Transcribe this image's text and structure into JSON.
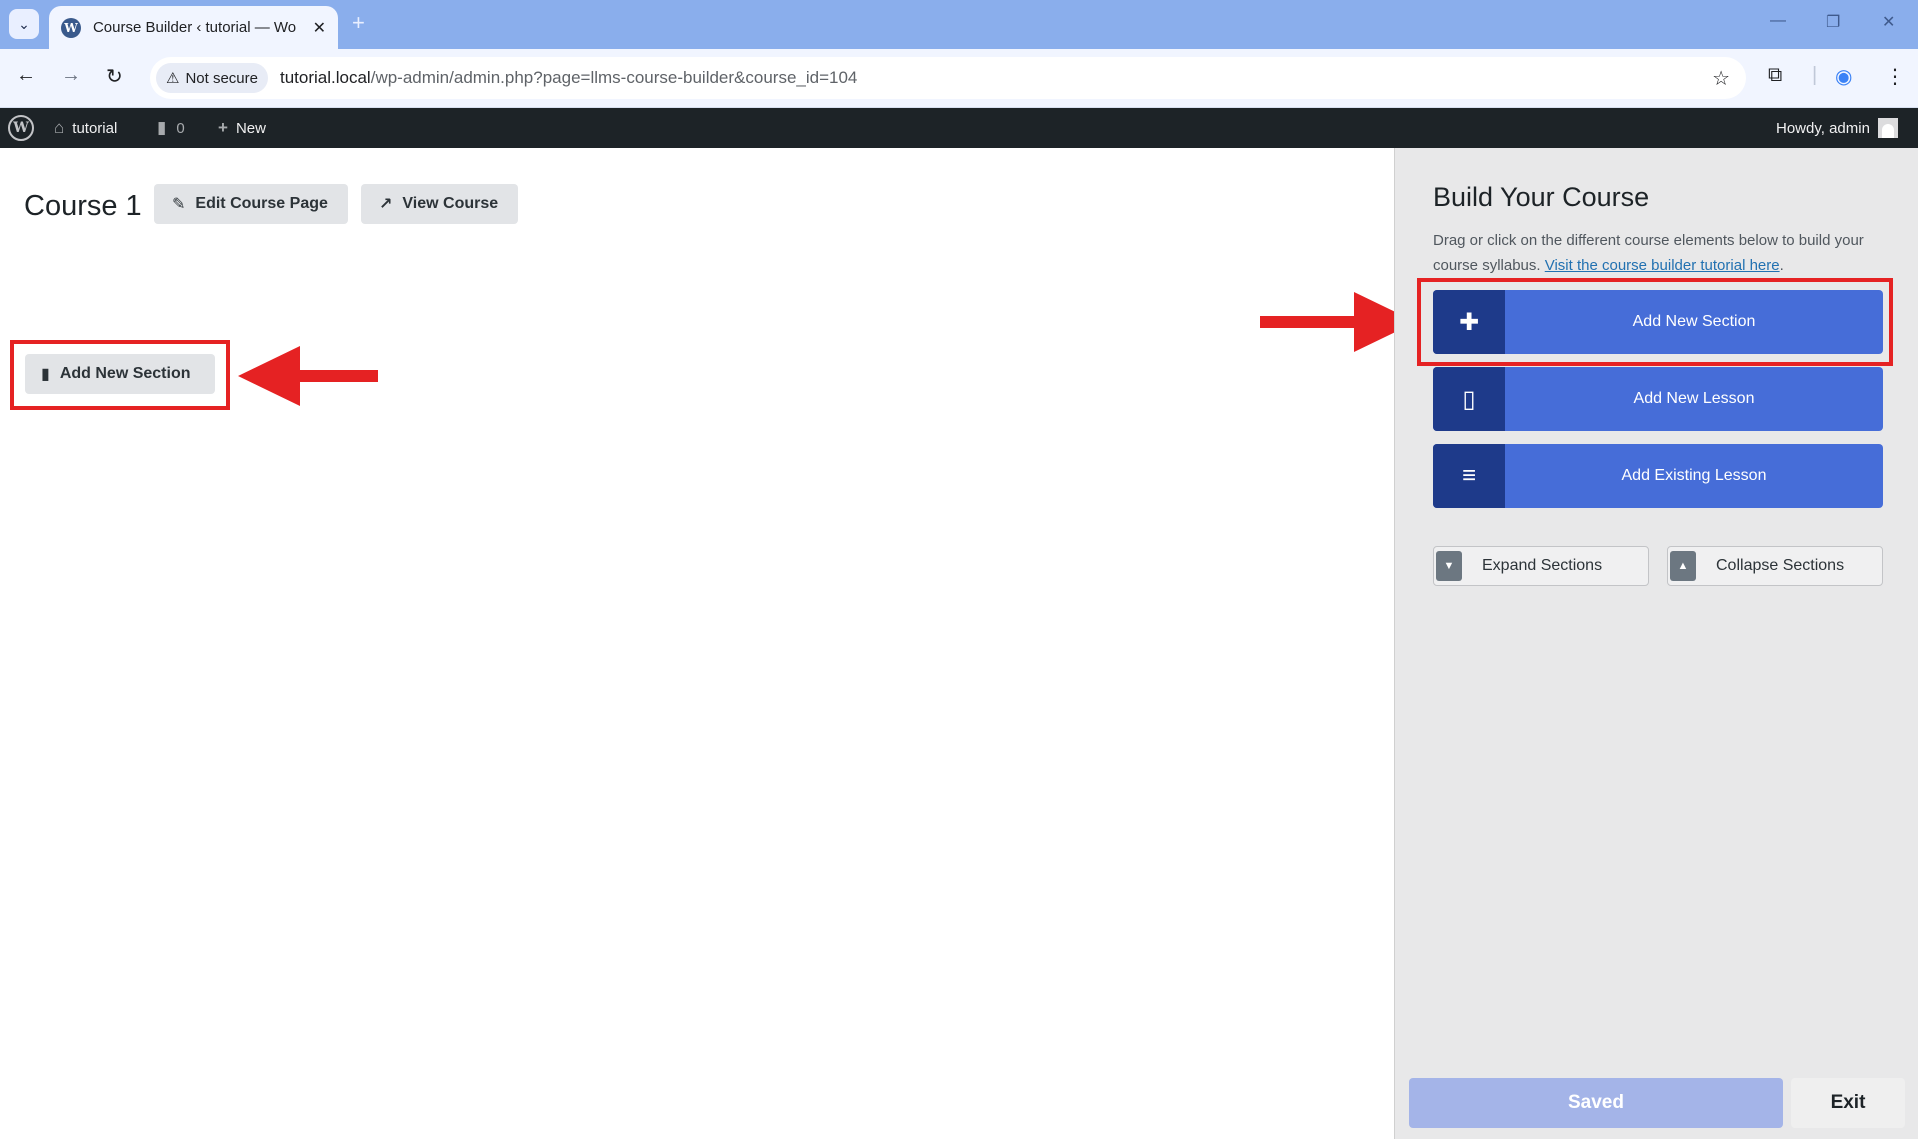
{
  "browser": {
    "tab_title": "Course Builder ‹ tutorial — Wo",
    "tab_favicon_letter": "W",
    "security_label": "Not secure",
    "url_host": "tutorial.local",
    "url_path": "/wp-admin/admin.php?page=llms-course-builder&course_id=104"
  },
  "wp_admin_bar": {
    "site_name": "tutorial",
    "comments_count": "0",
    "new_label": "New",
    "howdy": "Howdy, admin"
  },
  "main": {
    "course_title": "Course 1",
    "edit_course_page_label": "Edit Course Page",
    "view_course_label": "View Course",
    "add_new_section_label": "Add New Section"
  },
  "sidebar": {
    "title": "Build Your Course",
    "description": "Drag or click on the different course elements below to build your course syllabus.",
    "tutorial_link": "Visit the course builder tutorial here",
    "description_end": ".",
    "add_new_section": "Add New Section",
    "add_new_lesson": "Add New Lesson",
    "add_existing_lesson": "Add Existing Lesson",
    "expand_sections": "Expand Sections",
    "collapse_sections": "Collapse Sections",
    "saved": "Saved",
    "exit": "Exit"
  },
  "colors": {
    "accent_blue": "#466dd8",
    "accent_dark_blue": "#1e3a8a",
    "annotation_red": "#e52223",
    "wp_bar": "#1d2327"
  }
}
